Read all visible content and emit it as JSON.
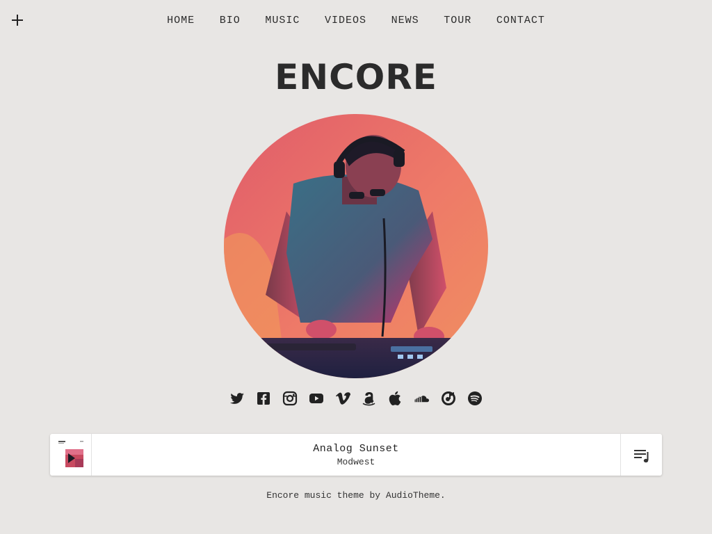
{
  "nav": {
    "items": [
      "HOME",
      "BIO",
      "MUSIC",
      "VIDEOS",
      "NEWS",
      "TOUR",
      "CONTACT"
    ]
  },
  "site": {
    "title": "ENCORE"
  },
  "social": {
    "icons": [
      "twitter-icon",
      "facebook-icon",
      "instagram-icon",
      "youtube-icon",
      "vimeo-icon",
      "amazon-icon",
      "apple-icon",
      "soundcloud-icon",
      "itunes-icon",
      "spotify-icon"
    ]
  },
  "player": {
    "track": "Analog Sunset",
    "artist": "Modwest"
  },
  "footer": {
    "prefix": "Encore music theme by ",
    "link": "AudioTheme",
    "suffix": "."
  },
  "colors": {
    "background": "#e8e6e4",
    "text": "#2b2b2b",
    "hero_pink": "#e8647a",
    "hero_orange": "#f0824e",
    "hero_magenta": "#c8306a"
  }
}
